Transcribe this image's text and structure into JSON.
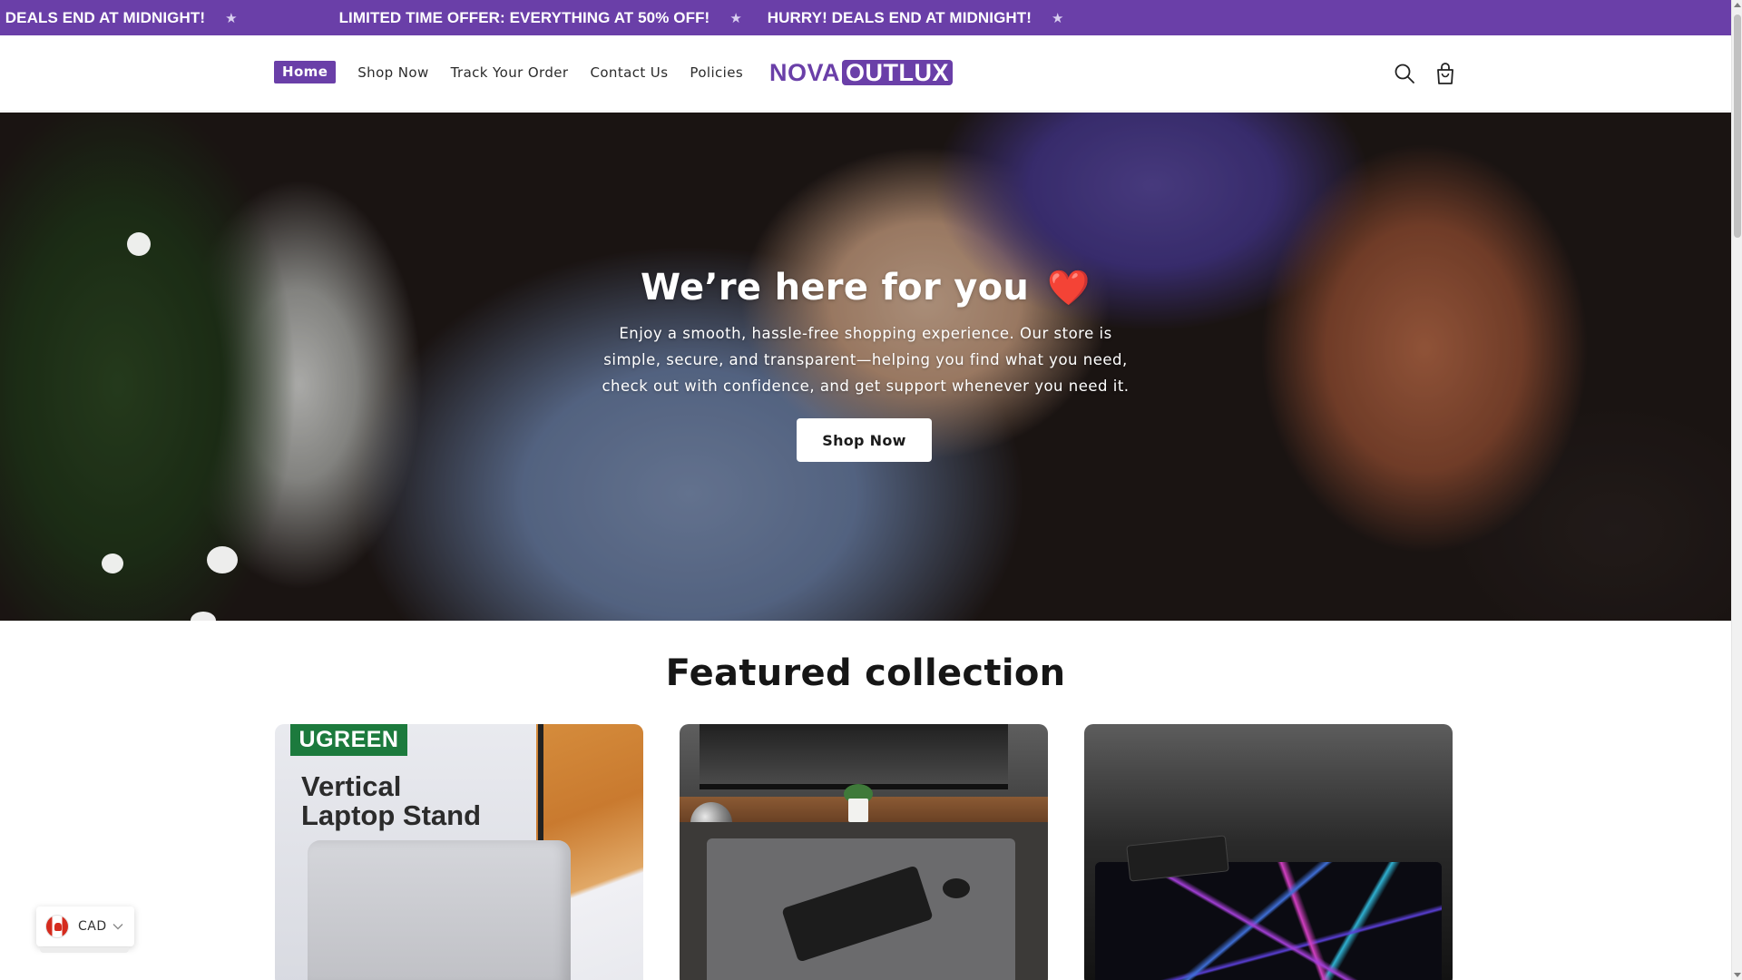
{
  "announcement": {
    "messages": [
      "RY! DEALS END AT MIDNIGHT!",
      "LIMITED TIME OFFER: EVERYTHING AT 50% OFF!",
      "HURRY! DEALS END AT MIDNIGHT!"
    ],
    "separator": "★"
  },
  "header": {
    "nav": [
      "Home",
      "Shop Now",
      "Track Your Order",
      "Contact Us",
      "Policies"
    ],
    "active_nav": "Home",
    "logo_part1": "NOVA",
    "logo_part2": "OUTLUX",
    "icons": [
      "search-icon",
      "shopping-bag-icon"
    ]
  },
  "hero": {
    "title": "We’re here for you",
    "emoji": "❤️",
    "text": "Enjoy a smooth, hassle-free shopping experience. Our store is simple, secure, and transparent—helping you find what you need, check out with confidence, and get support whenever you need it.",
    "button": "Shop Now"
  },
  "featured": {
    "title": "Featured collection",
    "cards": [
      {
        "brand": "UGREEN",
        "title_line1": "Vertical",
        "title_line2": "Laptop Stand"
      },
      {
        "brand": "",
        "title_line1": "",
        "title_line2": ""
      },
      {
        "brand": "",
        "title_line1": "",
        "title_line2": ""
      }
    ]
  },
  "currency": {
    "code": "CAD",
    "flag": "canada-flag-icon"
  },
  "colors": {
    "brand": "#6a3fa8",
    "announcement_bg": "#6a3fa8",
    "ugreen": "#1c7a3d"
  }
}
